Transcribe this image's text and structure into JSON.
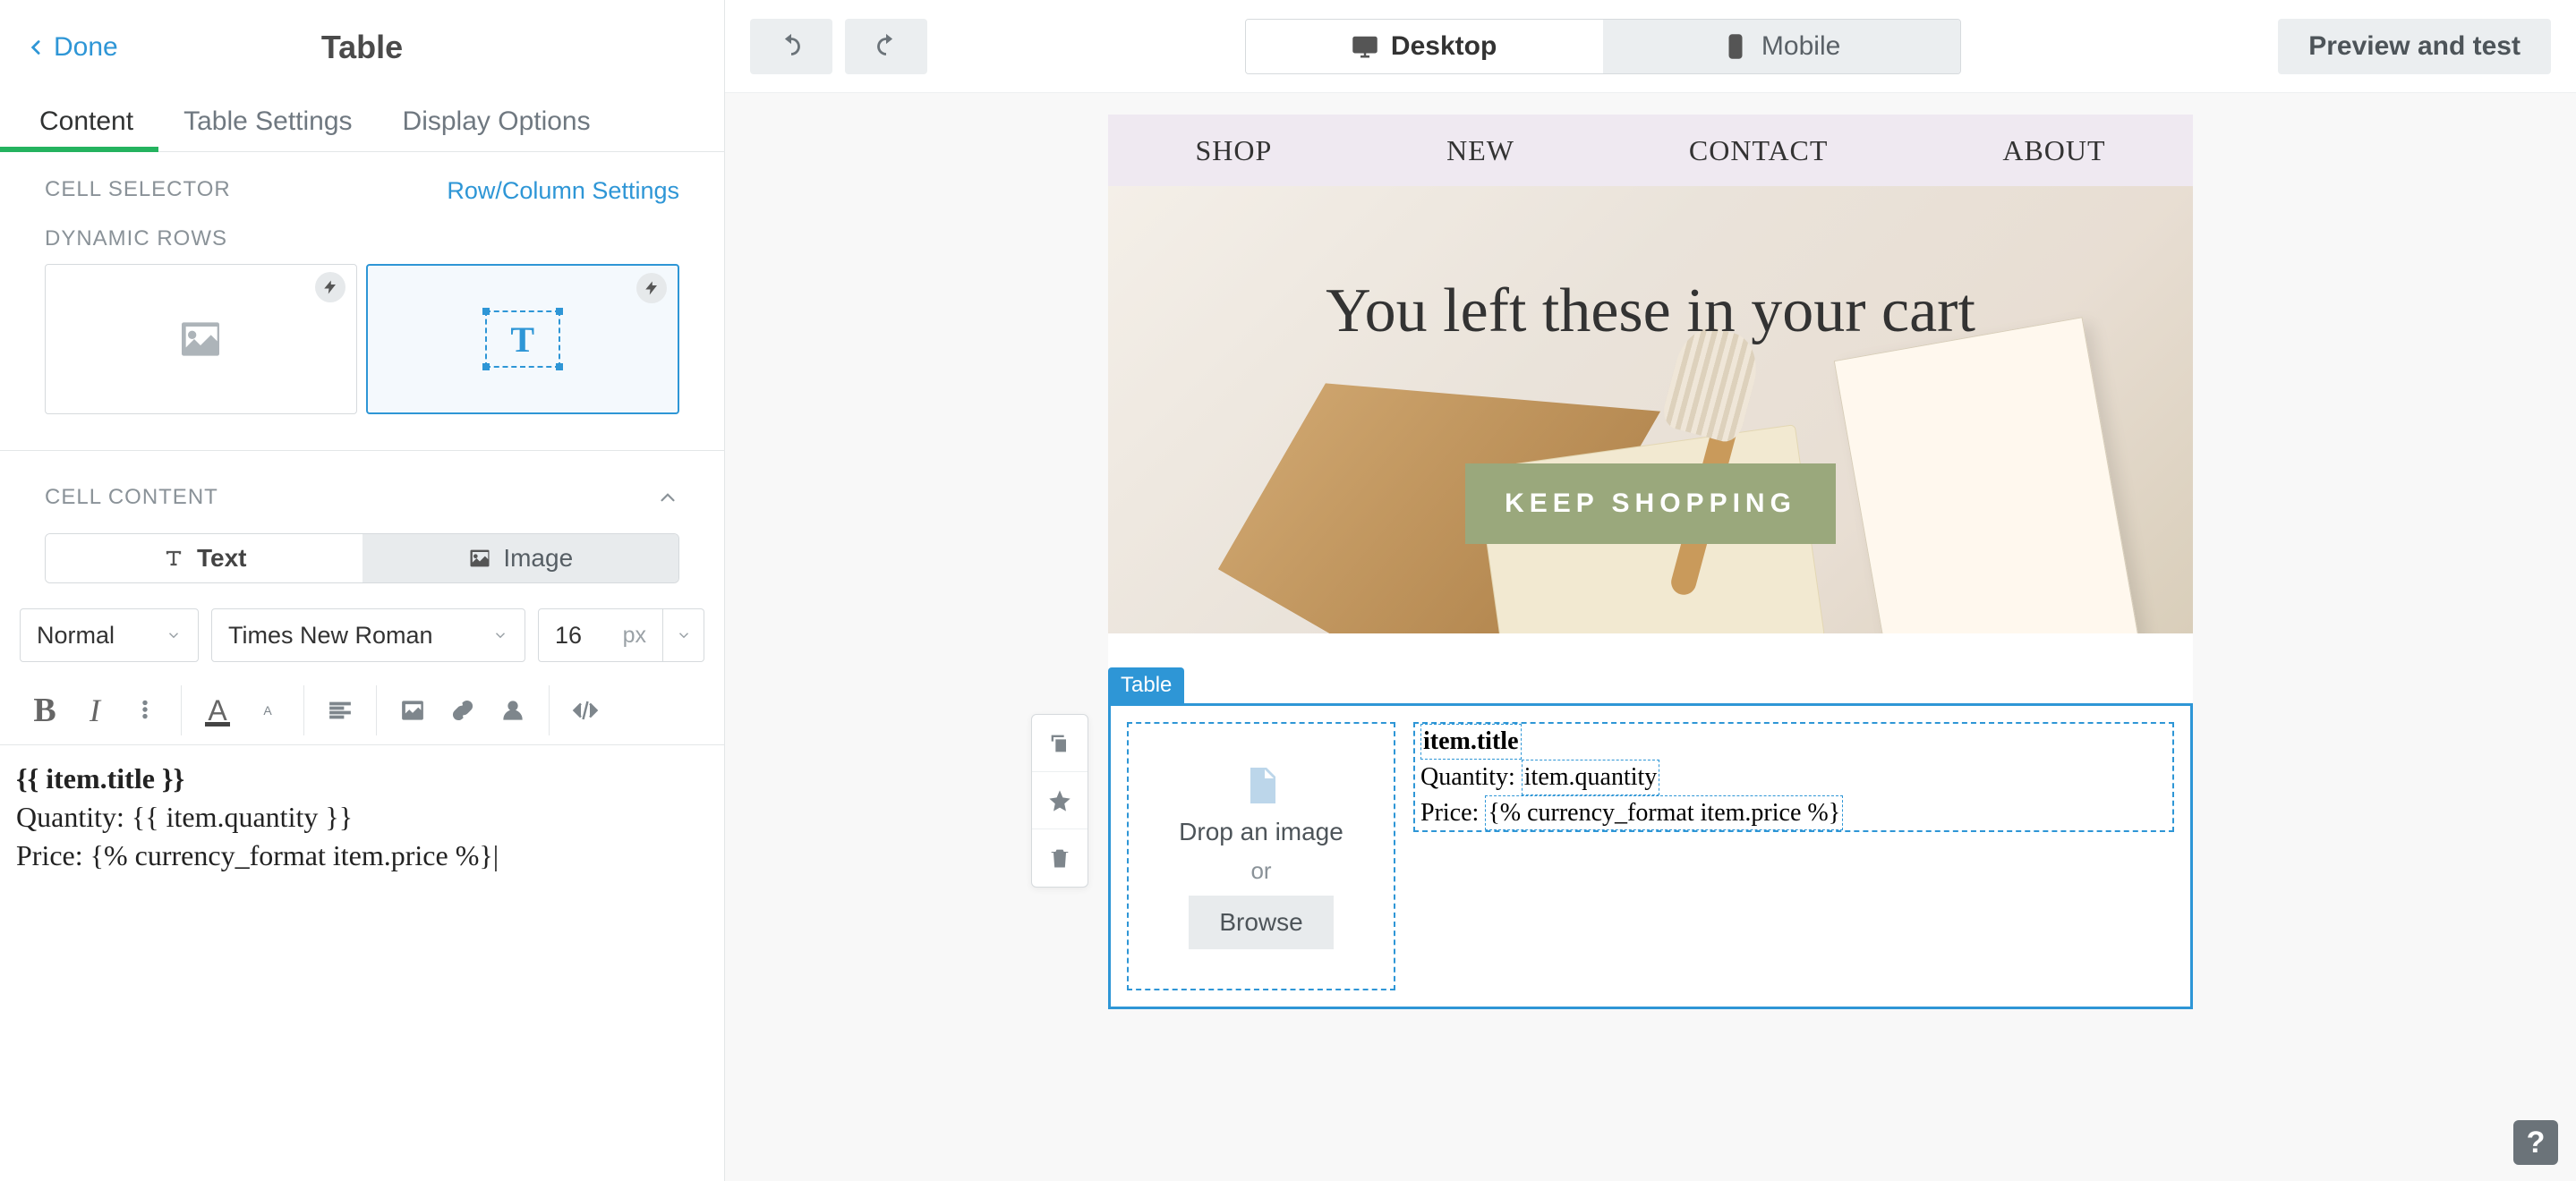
{
  "sidebar": {
    "back_label": "Done",
    "title": "Table",
    "tabs": {
      "content": "Content",
      "settings": "Table Settings",
      "display": "Display Options"
    },
    "cell_selector_label": "CELL SELECTOR",
    "row_col_settings_link": "Row/Column Settings",
    "dynamic_rows_label": "DYNAMIC ROWS",
    "cell_content_label": "CELL CONTENT",
    "seg": {
      "text": "Text",
      "image": "Image"
    },
    "font": {
      "style": "Normal",
      "family": "Times New Roman",
      "size": "16",
      "unit": "px"
    },
    "editor": {
      "line1": "{{ item.title }}",
      "line2": "Quantity: {{ item.quantity }}",
      "line3": "Price: {% currency_format item.price %}|"
    }
  },
  "topbar": {
    "desktop": "Desktop",
    "mobile": "Mobile",
    "preview": "Preview and test"
  },
  "email": {
    "nav": {
      "shop": "SHOP",
      "new_": "NEW",
      "contact": "CONTACT",
      "about": "ABOUT"
    },
    "hero_title": "You left these in your cart",
    "hero_cta": "KEEP SHOPPING"
  },
  "table": {
    "label": "Table",
    "dropzone": {
      "text": "Drop an image",
      "or_": "or",
      "browse": "Browse"
    },
    "cell": {
      "title_token": "item.title",
      "qty_prefix": "Quantity: ",
      "qty_token": "item.quantity",
      "price_prefix": "Price: ",
      "price_token": "{% currency_format item.price %}"
    }
  },
  "help": "?"
}
